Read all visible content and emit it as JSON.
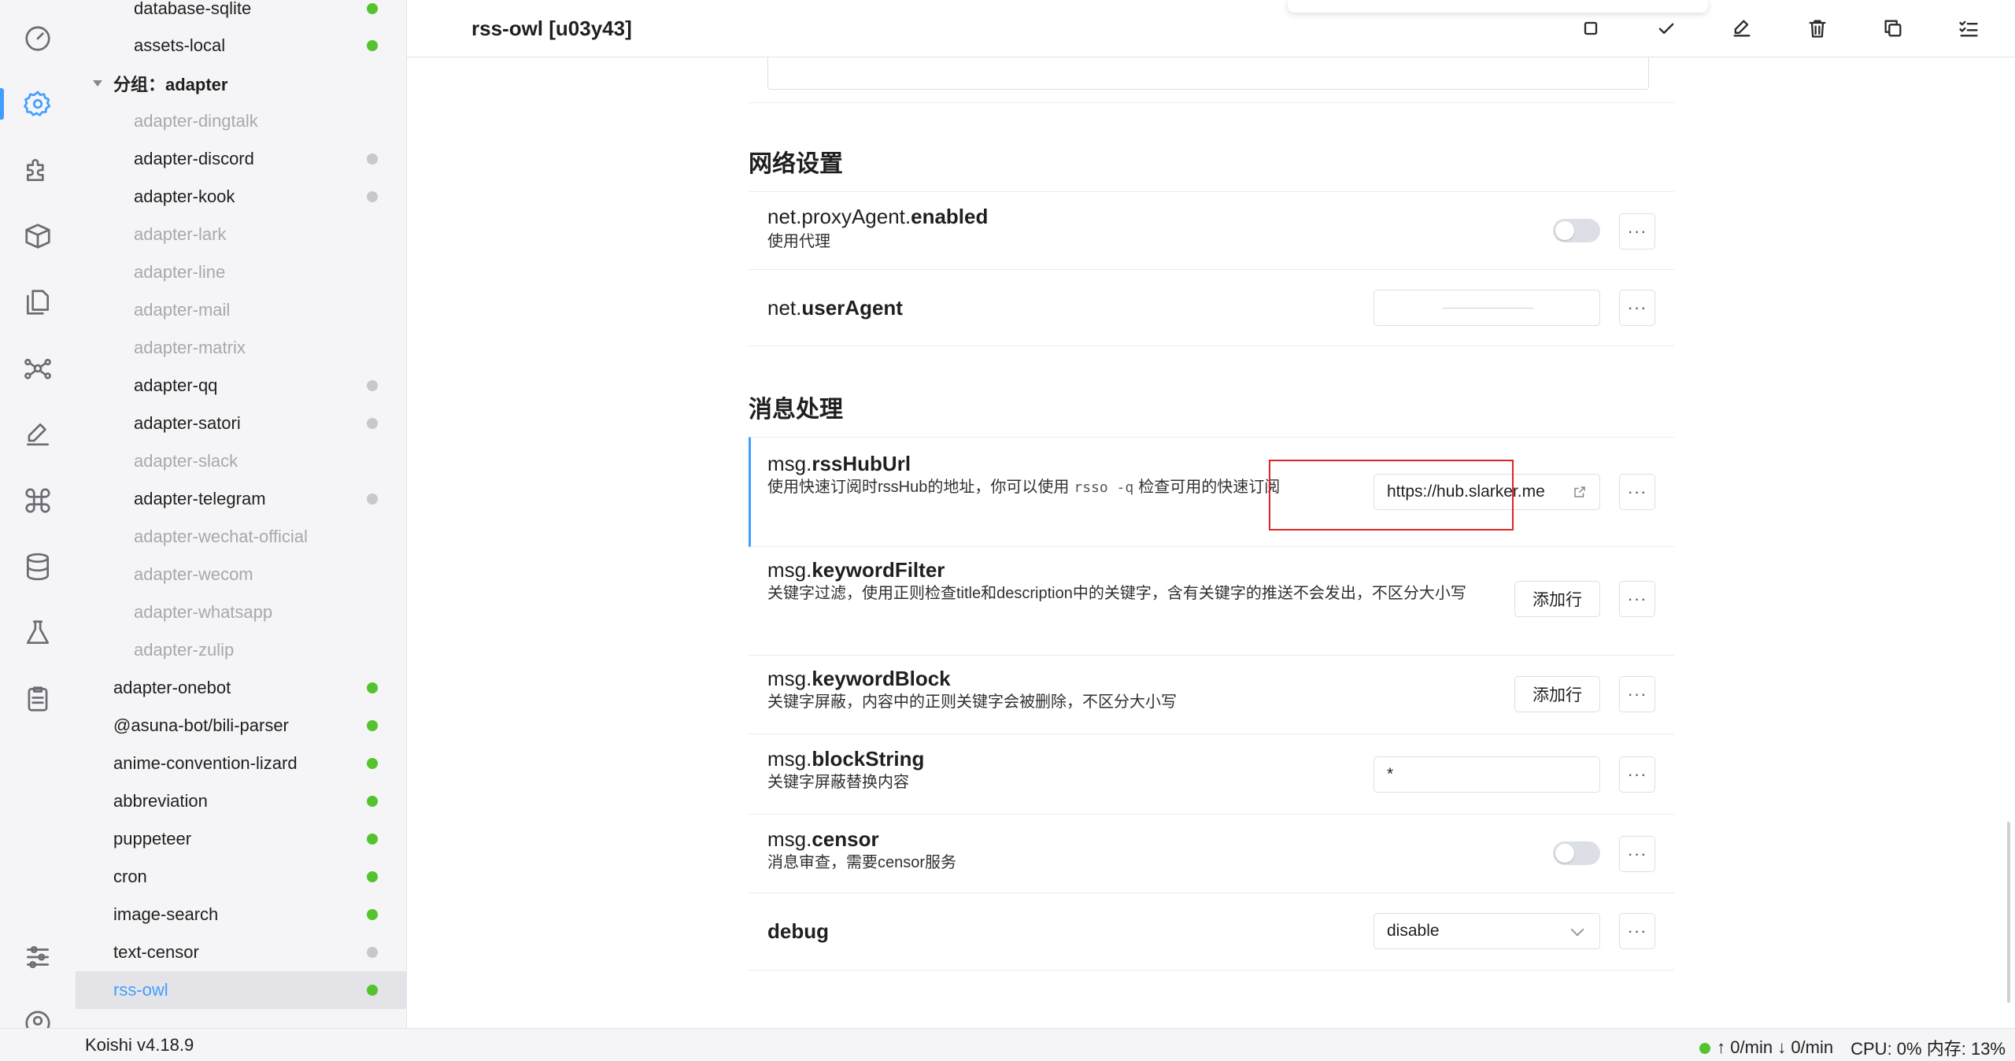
{
  "window": {
    "title": "rss-owl [u03y43]"
  },
  "activity_bar": [
    {
      "name": "dashboard-icon"
    },
    {
      "name": "settings-icon"
    },
    {
      "name": "plugins-icon"
    },
    {
      "name": "market-icon"
    },
    {
      "name": "files-icon"
    },
    {
      "name": "graph-icon"
    },
    {
      "name": "edit-icon"
    },
    {
      "name": "command-icon"
    },
    {
      "name": "database-icon"
    },
    {
      "name": "sandbox-icon"
    },
    {
      "name": "logs-icon"
    },
    {
      "name": "preferences-icon"
    },
    {
      "name": "user-icon"
    }
  ],
  "plugins": {
    "group_label": "分组：adapter",
    "items": [
      {
        "label": "database-sqlite",
        "status": "green"
      },
      {
        "label": "assets-local",
        "status": "green"
      },
      {
        "label": "adapter-dingtalk",
        "status": "disabled"
      },
      {
        "label": "adapter-discord",
        "status": "gray"
      },
      {
        "label": "adapter-kook",
        "status": "gray"
      },
      {
        "label": "adapter-lark",
        "status": "disabled"
      },
      {
        "label": "adapter-line",
        "status": "disabled"
      },
      {
        "label": "adapter-mail",
        "status": "disabled"
      },
      {
        "label": "adapter-matrix",
        "status": "disabled"
      },
      {
        "label": "adapter-qq",
        "status": "gray"
      },
      {
        "label": "adapter-satori",
        "status": "gray"
      },
      {
        "label": "adapter-slack",
        "status": "disabled"
      },
      {
        "label": "adapter-telegram",
        "status": "gray"
      },
      {
        "label": "adapter-wechat-official",
        "status": "disabled"
      },
      {
        "label": "adapter-wecom",
        "status": "disabled"
      },
      {
        "label": "adapter-whatsapp",
        "status": "disabled"
      },
      {
        "label": "adapter-zulip",
        "status": "disabled"
      },
      {
        "label": "adapter-onebot",
        "status": "green"
      },
      {
        "label": "@asuna-bot/bili-parser",
        "status": "green"
      },
      {
        "label": "anime-convention-lizard",
        "status": "green"
      },
      {
        "label": "abbreviation",
        "status": "green"
      },
      {
        "label": "puppeteer",
        "status": "green"
      },
      {
        "label": "cron",
        "status": "green"
      },
      {
        "label": "image-search",
        "status": "green"
      },
      {
        "label": "text-censor",
        "status": "gray"
      },
      {
        "label": "rss-owl",
        "status": "green"
      }
    ]
  },
  "toolbar": [
    {
      "name": "stop-icon"
    },
    {
      "name": "check-icon"
    },
    {
      "name": "edit-icon"
    },
    {
      "name": "delete-icon"
    },
    {
      "name": "copy-icon"
    },
    {
      "name": "checklist-icon"
    }
  ],
  "sections": {
    "network": {
      "title": "网络设置",
      "proxy": {
        "prefix": "net.proxyAgent.",
        "key": "enabled",
        "desc": "使用代理",
        "value": false
      },
      "ua": {
        "prefix": "net.",
        "key": "userAgent",
        "value": ""
      }
    },
    "message": {
      "title": "消息处理",
      "rsshub": {
        "prefix": "msg.",
        "key": "rssHubUrl",
        "desc_before": "使用快速订阅时rssHub的地址，你可以使用",
        "desc_code": "rsso -q",
        "desc_after": "检查可用的快速订阅",
        "value": "https://hub.slarker.me"
      },
      "keywordFilter": {
        "prefix": "msg.",
        "key": "keywordFilter",
        "desc": "关键字过滤，使用正则检查title和description中的关键字，含有关键字的推送不会发出，不区分大小写",
        "button": "添加行"
      },
      "keywordBlock": {
        "prefix": "msg.",
        "key": "keywordBlock",
        "desc": "关键字屏蔽，内容中的正则关键字会被删除，不区分大小写",
        "button": "添加行"
      },
      "blockString": {
        "prefix": "msg.",
        "key": "blockString",
        "desc": "关键字屏蔽替换内容",
        "value": "*"
      },
      "censor": {
        "prefix": "msg.",
        "key": "censor",
        "desc": "消息审查，需要censor服务",
        "value": false
      },
      "debug": {
        "key": "debug",
        "value": "disable"
      }
    }
  },
  "more_label": "···",
  "statusbar": {
    "version": "Koishi v4.18.9",
    "up": "↑ 0/min",
    "down": "↓ 0/min",
    "cpu": "CPU: 0%",
    "mem": "内存: 13%"
  },
  "colors": {
    "accent": "#409eff",
    "online": "#55c32d",
    "offline": "#c8c8cc",
    "highlight_box": "#e02424"
  }
}
